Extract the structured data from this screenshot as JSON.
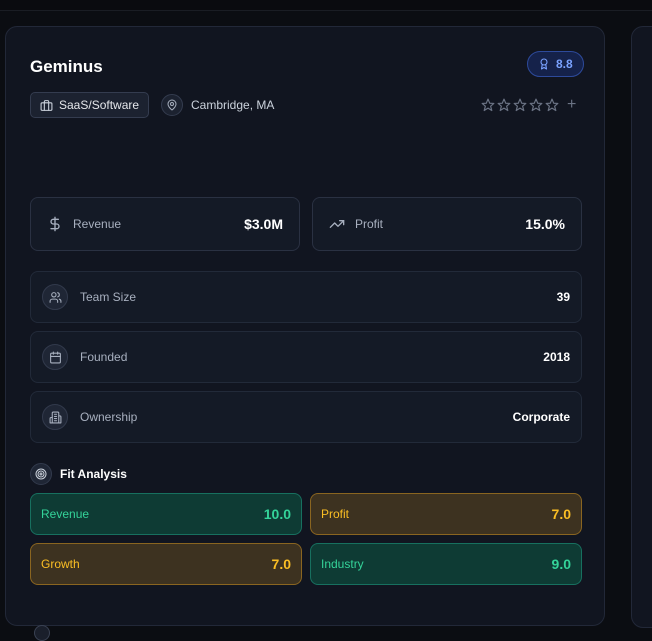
{
  "company": {
    "name": "Geminus",
    "score": "8.8",
    "industry": "SaaS/Software",
    "location": "Cambridge, MA",
    "rating_stars": 0,
    "rating_max": 5
  },
  "metrics": [
    {
      "label": "Revenue",
      "value": "$3.0M",
      "icon": "dollar-icon"
    },
    {
      "label": "Profit",
      "value": "15.0%",
      "icon": "trending-up-icon"
    }
  ],
  "details": [
    {
      "label": "Team Size",
      "value": "39",
      "icon": "users-icon"
    },
    {
      "label": "Founded",
      "value": "2018",
      "icon": "calendar-icon"
    },
    {
      "label": "Ownership",
      "value": "Corporate",
      "icon": "building-icon"
    }
  ],
  "fit": {
    "title": "Fit Analysis",
    "items": [
      {
        "label": "Revenue",
        "value": "10.0",
        "tone": "green"
      },
      {
        "label": "Profit",
        "value": "7.0",
        "tone": "amber"
      },
      {
        "label": "Growth",
        "value": "7.0",
        "tone": "amber"
      },
      {
        "label": "Industry",
        "value": "9.0",
        "tone": "green"
      }
    ]
  },
  "colors": {
    "background": "#0b0d12",
    "card": "#111520",
    "accent_blue": "#7aa2ff",
    "fit_green": "#34d399",
    "fit_amber": "#fbbf24"
  }
}
